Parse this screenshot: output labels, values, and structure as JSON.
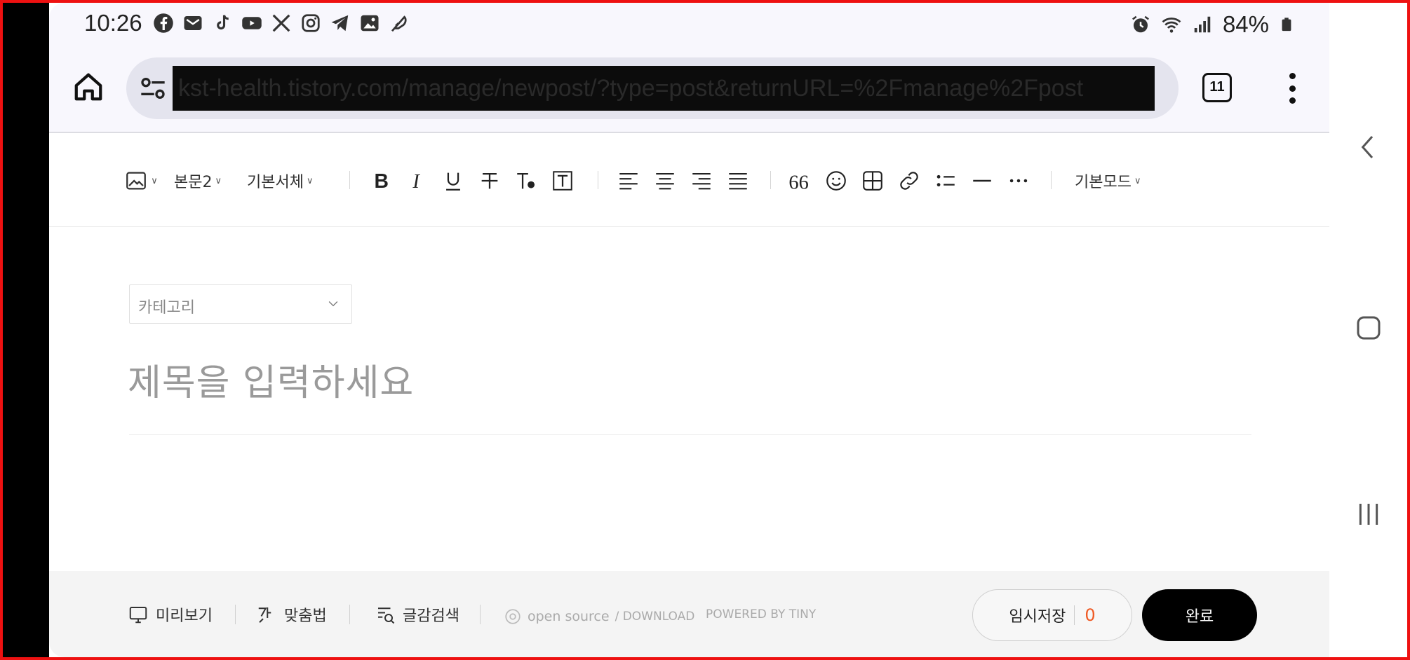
{
  "status_bar": {
    "time": "10:26",
    "battery": "84%",
    "app_icons": [
      "facebook-icon",
      "messages-icon",
      "tiktok-icon",
      "youtube-icon",
      "x-icon",
      "instagram-icon",
      "telegram-icon",
      "gallery-icon",
      "feather-icon"
    ],
    "right_icons": [
      "alarm-icon",
      "wifi-icon",
      "signal-icon",
      "battery-icon"
    ]
  },
  "browser": {
    "url": "kst-health.tistory.com/manage/newpost/?type=post&returnURL=%2Fmanage%2Fpost",
    "tab_count": "11"
  },
  "toolbar": {
    "text_style": "본문2",
    "font": "기본서체",
    "mode": "기본모드"
  },
  "editor": {
    "category_placeholder": "카테고리",
    "title_placeholder": "제목을 입력하세요"
  },
  "bottom_bar": {
    "preview": "미리보기",
    "spellcheck": "맞춤법",
    "search": "글감검색",
    "open_source": "open source",
    "download": "/ DOWNLOAD",
    "powered_by": "POWERED BY TINY",
    "temp_save": "임시저장",
    "temp_save_count": "0",
    "done": "완료"
  }
}
